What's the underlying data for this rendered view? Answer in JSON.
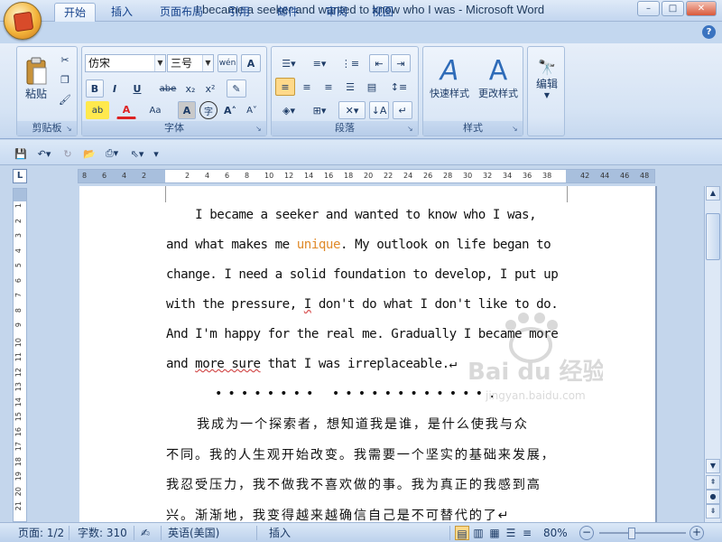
{
  "window": {
    "title": "I became a seeker and wanted to know who I was - Microsoft Word",
    "minimize": "–",
    "maximize": "□",
    "close": "✕"
  },
  "tabs": [
    "开始",
    "插入",
    "页面布局",
    "引用",
    "邮件",
    "审阅",
    "视图"
  ],
  "active_tab": "开始",
  "help": "?",
  "ribbon": {
    "clipboard": {
      "label": "剪贴板",
      "paste": "粘贴"
    },
    "font": {
      "label": "字体",
      "font_name": "仿宋",
      "font_size": "三号",
      "bold": "B",
      "italic": "I",
      "underline": "U",
      "strike": "abe",
      "subscript": "x₂",
      "superscript": "x²",
      "clear": "Aa",
      "grow": "A˄",
      "shrink": "A˅",
      "phonetic": "wén",
      "border": "A",
      "char_shading": "A",
      "enclose": "字",
      "font_color": "A",
      "highlight": "ab"
    },
    "paragraph": {
      "label": "段落"
    },
    "styles": {
      "label": "样式",
      "quick": "快速样式",
      "change": "更改样式"
    },
    "editing": {
      "label": "编辑"
    }
  },
  "rulers": {
    "h_ticks": [
      "8",
      "6",
      "4",
      "2",
      "2",
      "4",
      "6",
      "8",
      "10",
      "12",
      "14",
      "16",
      "18",
      "20",
      "22",
      "24",
      "26",
      "28",
      "30",
      "32",
      "34",
      "36",
      "38",
      "42",
      "44",
      "46",
      "48"
    ],
    "v_ticks": [
      "1",
      "2",
      "3",
      "4",
      "5",
      "6",
      "7",
      "8",
      "9",
      "10",
      "11",
      "12",
      "13",
      "14",
      "15",
      "16",
      "17",
      "18",
      "19",
      "20",
      "21"
    ]
  },
  "document": {
    "english_lines": [
      "    I became a seeker and wanted to know who I was,",
      "and what makes me ",
      "change. I need a solid foundation to develop, I put up",
      "with the pressure, ",
      "And I'm happy for the real me. Gradually I became more",
      "and "
    ],
    "word_unique": "unique",
    "line2_rest": ". My outlook on life began to",
    "line4_i": "I",
    "line4_rest": " don't do what I don't like to do.",
    "more_sure": "more sure",
    "line6_rest": " that I was irreplaceable.↵",
    "dots": "•••••••• ••••••••••••.",
    "chinese_lines": [
      "我成为一个探索者，想知道我是谁，是什么使我与众",
      "不同。我的人生观开始改变。我需要一个坚实的基础来发展，",
      "我忍受压力，我不做我不喜欢做的事。我为真正的我感到高",
      "兴。渐渐地，我变得越来越确信自己是不可替代的了↵"
    ]
  },
  "status": {
    "page": "页面: 1/2",
    "words": "字数: 310",
    "language": "英语(美国)",
    "mode": "插入",
    "zoom": "80%"
  },
  "watermark": {
    "brand": "Bai du 经验",
    "url": "jingyan.baidu.com"
  }
}
